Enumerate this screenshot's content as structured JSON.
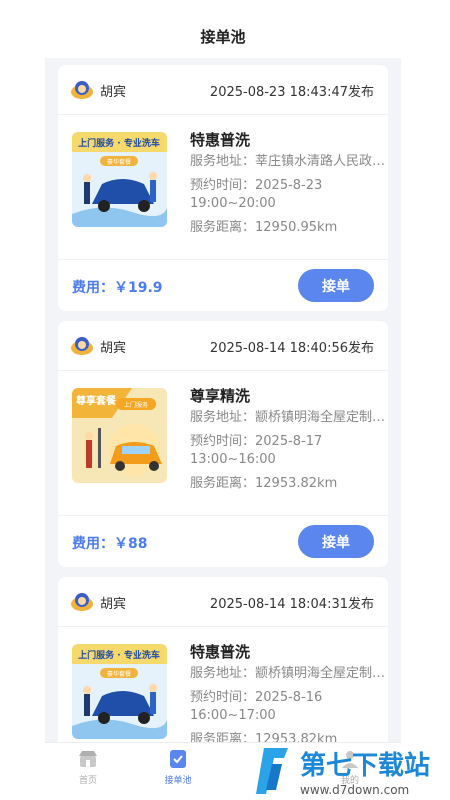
{
  "header": {
    "title": "接单池"
  },
  "orders": [
    {
      "user": "胡宾",
      "published": "2025-08-23 18:43:47发布",
      "service_name": "特惠普洗",
      "address_label": "服务地址：",
      "address": "莘庄镇水清路人民政…",
      "time_label": "预约时间：",
      "time_line1": "2025-8-23",
      "time_line2": "19:00~20:00",
      "distance_label": "服务距离：",
      "distance": "12950.95km",
      "fee_label": "费用：",
      "fee": "￥19.9",
      "accept_label": "接单",
      "thumb_banner": "上门服务 · 专业洗车",
      "thumb_tag": "豪华套餐"
    },
    {
      "user": "胡宾",
      "published": "2025-08-14 18:40:56发布",
      "service_name": "尊享精洗",
      "address_label": "服务地址：",
      "address": "颛桥镇明海全屋定制…",
      "time_label": "预约时间：",
      "time_line1": "2025-8-17",
      "time_line2": "13:00~16:00",
      "distance_label": "服务距离：",
      "distance": "12953.82km",
      "fee_label": "费用：",
      "fee": "￥88",
      "accept_label": "接单",
      "thumb_banner": "尊享套餐",
      "thumb_tag": "上门服务"
    },
    {
      "user": "胡宾",
      "published": "2025-08-14 18:04:31发布",
      "service_name": "特惠普洗",
      "address_label": "服务地址：",
      "address": "颛桥镇明海全屋定制…",
      "time_label": "预约时间：",
      "time_line1": "2025-8-16",
      "time_line2": "16:00~17:00",
      "distance_label": "服务距离：",
      "distance": "12953.82km",
      "thumb_banner": "上门服务 · 专业洗车",
      "thumb_tag": "豪华套餐"
    }
  ],
  "tabbar": {
    "home": "首页",
    "pool": "接单池",
    "mine": "我的"
  },
  "watermark": {
    "title": "第七下载站",
    "url": "www.d7down.com"
  },
  "colors": {
    "accent": "#5a86ee",
    "fee": "#4d7bf0",
    "bg": "#f3f4f8"
  }
}
